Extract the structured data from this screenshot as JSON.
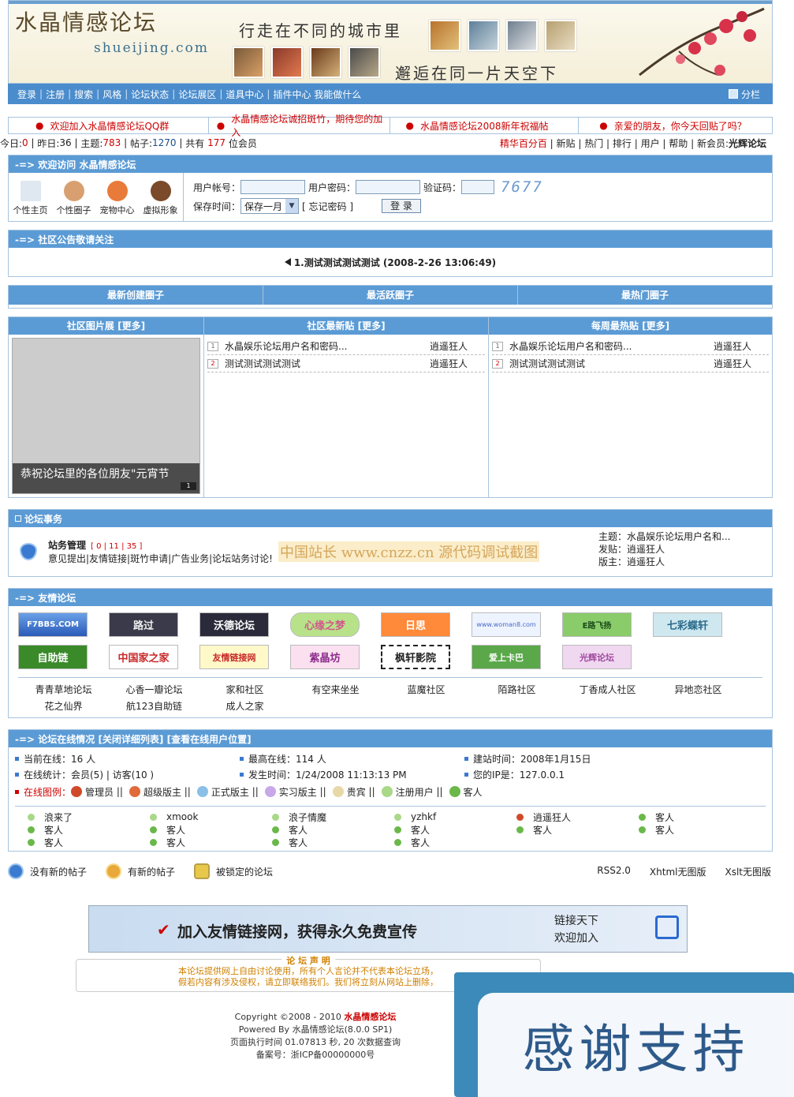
{
  "header": {
    "logo_cn": "水晶情感论坛",
    "logo_en": "shueijing.com",
    "slogan_top": "行走在不同的城市里",
    "slogan_bottom": "邂逅在同一片天空下"
  },
  "nav": {
    "items": [
      "登录",
      "注册",
      "搜索",
      "风格",
      "论坛状态",
      "论坛展区",
      "道具中心",
      "插件中心 我能做什么"
    ],
    "split_label": "分栏"
  },
  "notices": [
    "欢迎加入水晶情感论坛QQ群",
    "水晶情感论坛诚招斑竹，期待您的加入",
    "水晶情感论坛2008新年祝福帖",
    "亲爱的朋友，你今天回贴了吗？"
  ],
  "stats": {
    "today_label": "今日:",
    "today": "0",
    "yesterday_label": "昨日:",
    "yesterday": "36",
    "topics_label": "主题:",
    "topics": "783",
    "posts_label": "帖子:",
    "posts": "1270",
    "total_prefix": "共有",
    "total": "177",
    "total_suffix": "位会员",
    "right_links": [
      "精华百分百",
      "新贴",
      "热门",
      "排行",
      "用户",
      "帮助"
    ],
    "newest_label": "新会员:",
    "newest": "光辉论坛"
  },
  "welcome": {
    "title": "-=> 欢迎访问 水晶情感论坛",
    "quick": [
      "个性主页",
      "个性圈子",
      "宠物中心",
      "虚拟形象"
    ],
    "user_label": "用户帐号：",
    "pass_label": "用户密码：",
    "code_label": "验证码：",
    "captcha": "7677",
    "save_label": "保存时间：",
    "save_value": "保存一月",
    "forgot": "[ 忘记密码 ]",
    "login_btn": "登 录"
  },
  "announce": {
    "title": "-=> 社区公告敬请关注",
    "text": "1.测试测试测试测试 (2008-2-26 13:06:49)"
  },
  "circles": [
    "最新创建圈子",
    "最活跃圈子",
    "最热门圈子"
  ],
  "gallery": {
    "title": "社区图片展 [更多]",
    "caption": "恭祝论坛里的各位朋友\"元宵节",
    "page": "1"
  },
  "latest": {
    "title": "社区最新贴 [更多]",
    "posts": [
      {
        "n": "1",
        "t": "水晶娱乐论坛用户名和密码...",
        "a": "逍遥狂人"
      },
      {
        "n": "2",
        "t": "测试测试测试测试",
        "a": "逍遥狂人"
      }
    ]
  },
  "weekly": {
    "title": "每周最热贴 [更多]",
    "posts": [
      {
        "n": "1",
        "t": "水晶娱乐论坛用户名和密码...",
        "a": "逍遥狂人"
      },
      {
        "n": "2",
        "t": "测试测试测试测试",
        "a": "逍遥狂人"
      }
    ]
  },
  "affairs": {
    "title": "论坛事务",
    "board": "站务管理",
    "counts": "[ 0 | 11 | 35 ]",
    "desc": "意见提出|友情链接|斑竹申请|广告业务|论坛站务讨论!",
    "watermark": "中国站长 www.cnzz.cn 源代码调试截图",
    "topic": "主题：水晶娱乐论坛用户名和...",
    "poster": "发贴：逍遥狂人",
    "moderator": "版主：逍遥狂人"
  },
  "links": {
    "title": "-=> 友情论坛",
    "banners": [
      "F7BBS.COM",
      "路过",
      "沃德论坛",
      "心缘之梦",
      "日思",
      "www.woman8.com",
      "E路飞扬",
      "七彩蝶轩",
      "自助链",
      "中国家之家",
      "友情链接网",
      "紫晶坊",
      "枫轩影院",
      "爱上卡巴",
      "光辉论坛"
    ],
    "text": [
      "青青草地论坛",
      "心香一瓣论坛",
      "家和社区",
      "有空来坐坐",
      "蓝魔社区",
      "陌路社区",
      "丁香成人社区",
      "异地恋社区",
      "花之仙界",
      "航123自助链",
      "成人之家"
    ]
  },
  "online": {
    "title": "-=> 论坛在线情况 [关闭详细列表] [查看在线用户位置]",
    "current": "当前在线：16 人",
    "peak": "最高在线：114 人",
    "built": "建站时间：2008年1月15日",
    "stat": "在线统计：会员(5) | 访客(10 )",
    "peak_time": "发生时间：1/24/2008 11:13:13 PM",
    "ip": "您的IP是：127.0.0.1",
    "legend_label": "在线图例：",
    "legend": [
      "管理员",
      "超级版主",
      "正式版主",
      "实习版主",
      "贵宾",
      "注册用户",
      "客人"
    ],
    "users": [
      "浪来了",
      "xmook",
      "浪子情魔",
      "yzhkf",
      "逍遥狂人",
      "客人",
      "客人",
      "客人",
      "客人",
      "客人",
      "客人",
      "客人",
      "客人",
      "客人",
      "客人",
      "客人"
    ]
  },
  "legend2": {
    "items": [
      "没有新的帖子",
      "有新的帖子",
      "被锁定的论坛"
    ],
    "right": [
      "RSS2.0",
      "Xhtml无图版",
      "Xslt无图版"
    ]
  },
  "ad": {
    "text": "加入友情链接网，获得永久免费宣传",
    "r1": "链接天下",
    "r2": "欢迎加入"
  },
  "decl": {
    "title": "论 坛 声 明",
    "l1": "本论坛提供网上自由讨论使用，所有个人言论并不代表本论坛立场，",
    "l2": "假若内容有涉及侵权，请立即联络我们。我们将立刻从网站上删除，"
  },
  "footer": {
    "copy": "Copyright ©2008 - 2010",
    "site": "水晶情感论坛",
    "powered": "Powered By 水晶情感论坛(8.0.0 SP1)",
    "exec": "页面执行时间 01.07813 秒, 20 次数据查询",
    "icp": "备案号：浙ICP备00000000号"
  },
  "thanks": "感谢支持"
}
